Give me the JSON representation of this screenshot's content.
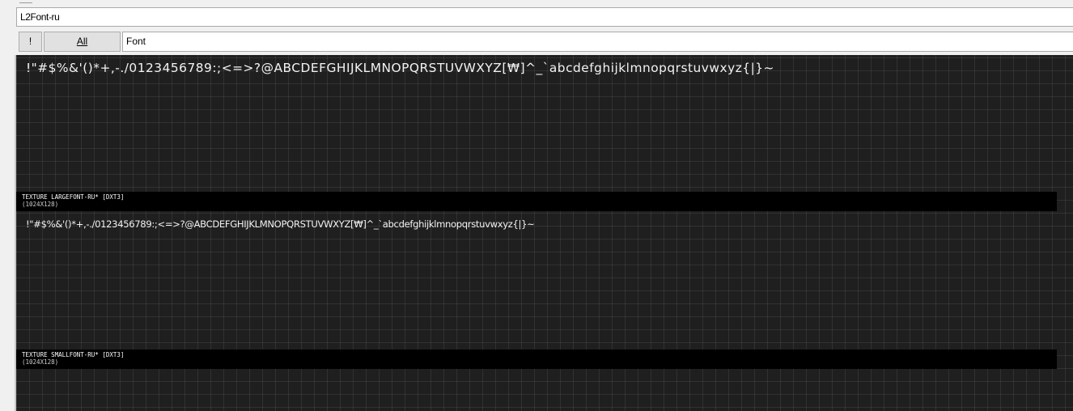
{
  "package": {
    "name": "L2Font-ru"
  },
  "toolbar": {
    "bang_label": "!",
    "all_label": "All",
    "filter_value": "Font"
  },
  "viewer": {
    "textures": [
      {
        "preview_text": "!\"#$%&'()*+,-./0123456789:;<=>?@ABCDEFGHIJKLMNOPQRSTUVWXYZ[₩]^_`abcdefghijklmnopqrstuvwxyz{|}~",
        "title": "TEXTURE LARGEFONT-RU* [DXT3]",
        "size": "(1024X128)"
      },
      {
        "preview_text": "!\"#$%&'()*+,-./0123456789:;<=>?@ABCDEFGHIJKLMNOPQRSTUVWXYZ[₩]^_`abcdefghijklmnopqrstuvwxyz{|}~",
        "title": "TEXTURE SMALLFONT-RU* [DXT3]",
        "size": "(1024X128)"
      }
    ]
  },
  "colors": {
    "viewer_background": "#1f1f1f",
    "label_background": "#000000",
    "glyph_color": "#f2f2f2"
  }
}
